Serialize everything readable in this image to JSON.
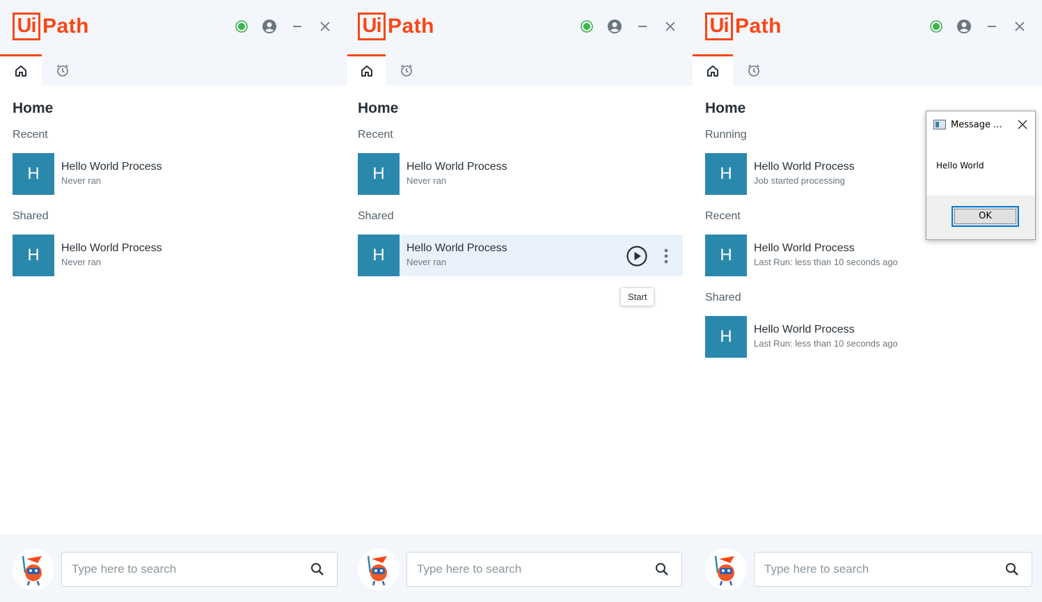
{
  "app": {
    "brand_box": "Ui",
    "brand_text": "Path",
    "brand_color": "#fa4616",
    "status_color": "#3ab54a",
    "avatar_color": "#2a88ad"
  },
  "titlebar_icons": [
    "status-online-icon",
    "user-account-icon",
    "minimize-icon",
    "close-icon"
  ],
  "tabs": [
    {
      "name": "home",
      "icon": "home-icon",
      "active": true
    },
    {
      "name": "triggers",
      "icon": "alarm-clock-icon",
      "active": false
    }
  ],
  "panels": [
    {
      "heading": "Home",
      "sections": [
        {
          "label": "Recent",
          "items": [
            {
              "avatar": "H",
              "name": "Hello World Process",
              "status": "Never ran"
            }
          ]
        },
        {
          "label": "Shared",
          "items": [
            {
              "avatar": "H",
              "name": "Hello World Process",
              "status": "Never ran"
            }
          ]
        }
      ],
      "search_placeholder": "Type here to search"
    },
    {
      "heading": "Home",
      "sections": [
        {
          "label": "Recent",
          "items": [
            {
              "avatar": "H",
              "name": "Hello World Process",
              "status": "Never ran"
            }
          ]
        },
        {
          "label": "Shared",
          "items": [
            {
              "avatar": "H",
              "name": "Hello World Process",
              "status": "Never ran",
              "hovered": true
            }
          ]
        }
      ],
      "tooltip": "Start",
      "search_placeholder": "Type here to search"
    },
    {
      "heading": "Home",
      "sections": [
        {
          "label": "Running",
          "items": [
            {
              "avatar": "H",
              "name": "Hello World Process",
              "status": "Job started processing"
            }
          ]
        },
        {
          "label": "Recent",
          "items": [
            {
              "avatar": "H",
              "name": "Hello World Process",
              "status": "Last Run: less than 10 seconds ago"
            }
          ]
        },
        {
          "label": "Shared",
          "items": [
            {
              "avatar": "H",
              "name": "Hello World Process",
              "status": "Last Run: less than 10 seconds ago"
            }
          ]
        }
      ],
      "search_placeholder": "Type here to search"
    }
  ],
  "message_dialog": {
    "title": "Message ...",
    "message": "Hello World",
    "ok_label": "OK"
  }
}
